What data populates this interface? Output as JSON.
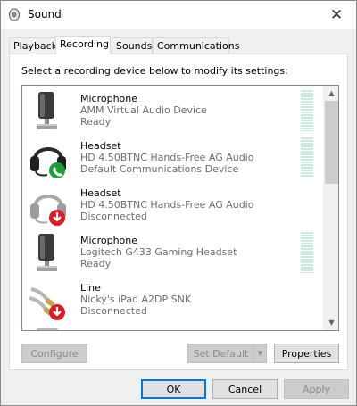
{
  "window": {
    "title": "Sound",
    "close_symbol": "✕"
  },
  "tabs": [
    {
      "label": "Playback",
      "active": false
    },
    {
      "label": "Recording",
      "active": true
    },
    {
      "label": "Sounds",
      "active": false
    },
    {
      "label": "Communications",
      "active": false
    }
  ],
  "instruction": "Select a recording device below to modify its settings:",
  "devices": [
    {
      "name": "Microphone",
      "detail": "AMM Virtual Audio Device",
      "status": "Ready",
      "icon": "microphone-icon",
      "badge": null,
      "meter": true
    },
    {
      "name": "Headset",
      "detail": "HD 4.50BTNC Hands-Free AG Audio",
      "status": "Default Communications Device",
      "icon": "headset-icon",
      "badge": "phone-badge-icon",
      "meter": true
    },
    {
      "name": "Headset",
      "detail": "HD 4.50BTNC Hands-Free AG Audio",
      "status": "Disconnected",
      "icon": "headset-icon",
      "badge": "disconnected-badge-icon",
      "meter": false
    },
    {
      "name": "Microphone",
      "detail": "Logitech G433 Gaming Headset",
      "status": "Ready",
      "icon": "microphone-icon",
      "badge": null,
      "meter": true
    },
    {
      "name": "Line",
      "detail": "Nicky's iPad A2DP SNK",
      "status": "Disconnected",
      "icon": "line-in-icon",
      "badge": "disconnected-badge-icon",
      "meter": false
    }
  ],
  "buttons": {
    "configure": "Configure",
    "set_default": "Set Default",
    "properties": "Properties",
    "ok": "OK",
    "cancel": "Cancel",
    "apply": "Apply"
  },
  "colors": {
    "accent": "#0078d7",
    "phone_badge": "#1e9e3a",
    "disconnected_badge": "#d3202a",
    "meter": "#c8e8e0"
  }
}
